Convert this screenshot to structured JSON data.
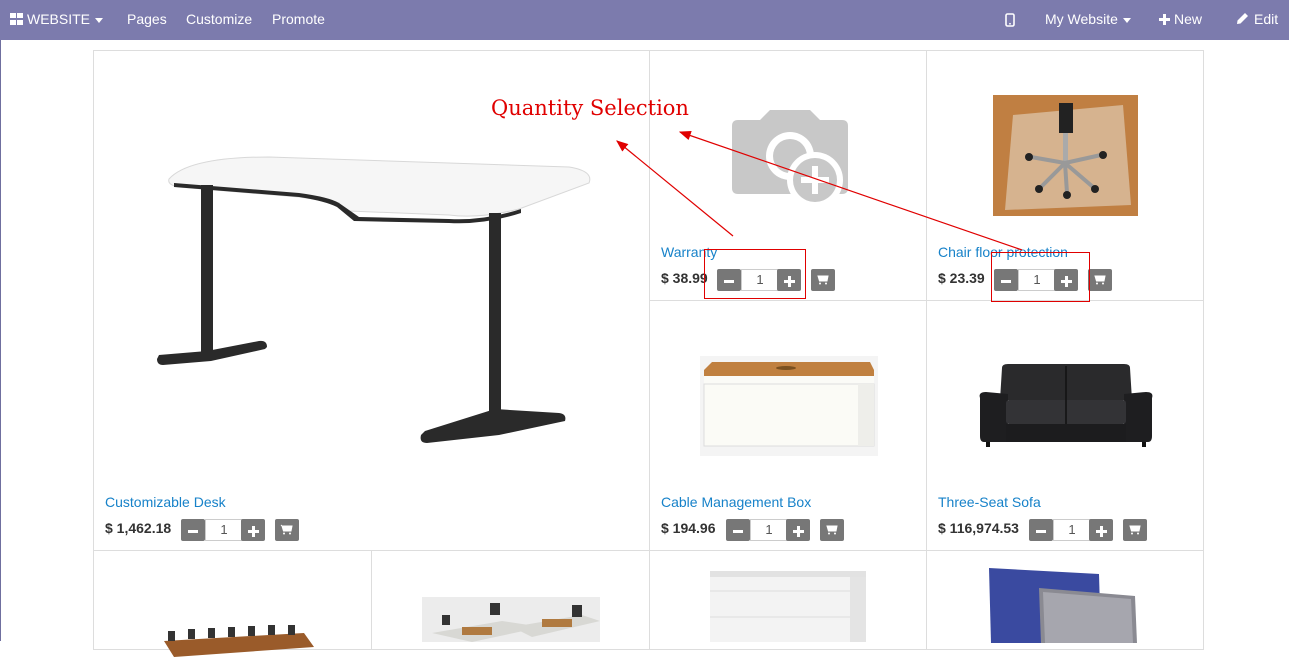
{
  "topbar": {
    "website_label": "WEBSITE",
    "pages": "Pages",
    "customize": "Customize",
    "promote": "Promote",
    "my_website": "My Website",
    "new": "New",
    "edit": "Edit"
  },
  "annotation": {
    "label": "Quantity Selection"
  },
  "products": [
    {
      "name": "Customizable Desk",
      "price": "$ 1,462.18",
      "qty": "1"
    },
    {
      "name": "Warranty",
      "price": "$ 38.99",
      "qty": "1"
    },
    {
      "name": "Chair floor protection",
      "price": "$ 23.39",
      "qty": "1"
    },
    {
      "name": "Cable Management Box",
      "price": "$ 194.96",
      "qty": "1"
    },
    {
      "name": "Three-Seat Sofa",
      "price": "$ 116,974.53",
      "qty": "1"
    }
  ],
  "colors": {
    "topbar": "#7c7bad",
    "link": "#1782c9",
    "annotation": "#e00000",
    "button": "#777777"
  },
  "icons": [
    "grid-icon",
    "mobile-icon",
    "plus-icon",
    "pencil-icon",
    "minus-icon",
    "cart-icon",
    "camera-placeholder-icon"
  ]
}
